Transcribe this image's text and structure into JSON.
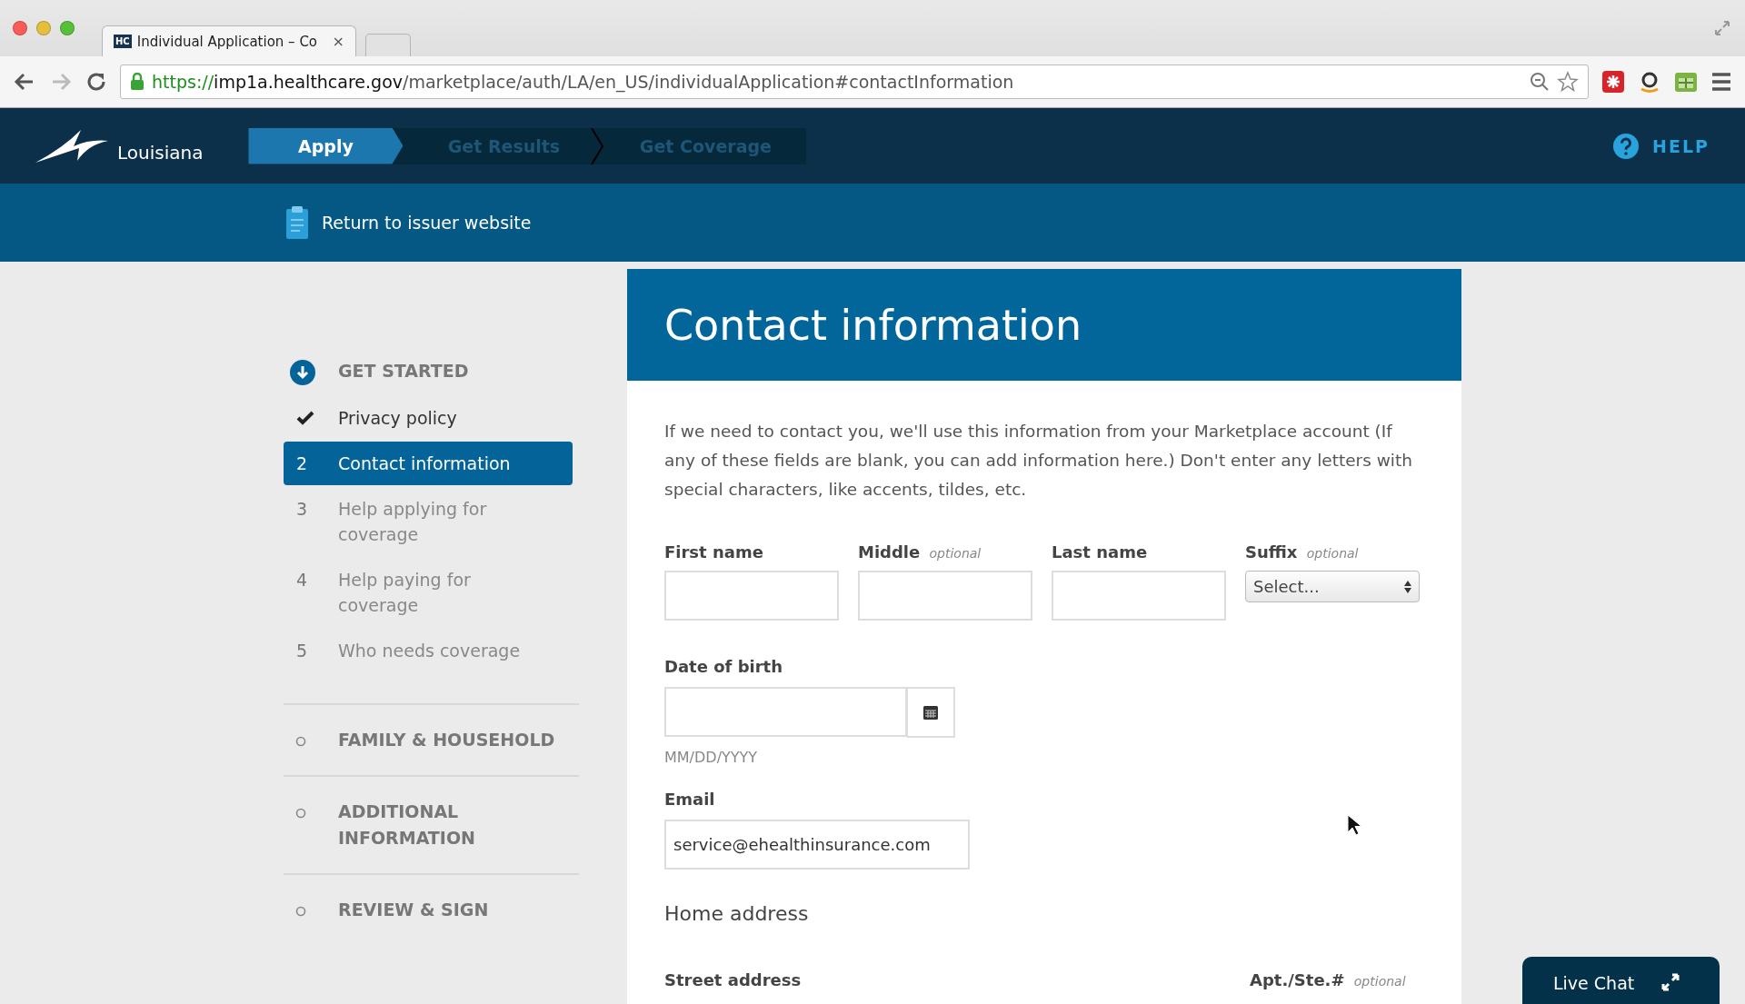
{
  "browser": {
    "tab_favicon": "HC",
    "tab_title": "Individual Application – Co",
    "tab_close": "×",
    "url_scheme": "https://",
    "url_host": "imp1a.healthcare.gov",
    "url_path": "/marketplace/auth/LA/en_US/individualApplication#contactInformation"
  },
  "nav": {
    "brand": "Louisiana",
    "steps": [
      {
        "label": "Apply",
        "selected": true
      },
      {
        "label": "Get Results",
        "selected": false
      },
      {
        "label": "Get Coverage",
        "selected": false
      }
    ],
    "help": "HELP"
  },
  "subbar": {
    "link": "Return to issuer website"
  },
  "sidebar": {
    "sections": [
      {
        "title": "GET STARTED",
        "kind": "current",
        "items": [
          {
            "kind": "done",
            "label": "Privacy policy",
            "selected": false
          },
          {
            "kind": "numbered",
            "number": "2",
            "label": "Contact information",
            "selected": true
          },
          {
            "kind": "numbered",
            "number": "3",
            "label": "Help applying for coverage",
            "selected": false
          },
          {
            "kind": "numbered",
            "number": "4",
            "label": "Help paying for coverage",
            "selected": false
          },
          {
            "kind": "numbered",
            "number": "5",
            "label": "Who needs coverage",
            "selected": false
          }
        ]
      },
      {
        "title": "FAMILY & HOUSEHOLD",
        "kind": "pending"
      },
      {
        "title": "ADDITIONAL INFORMATION",
        "kind": "pending"
      },
      {
        "title": "REVIEW & SIGN",
        "kind": "pending"
      }
    ]
  },
  "form": {
    "title": "Contact information",
    "intro": "If we need to contact you, we'll use this information from your Marketplace account (If any of these fields are blank, you can add information here.) Don't enter any letters with special characters, like accents, tildes, etc.",
    "name_fields": [
      {
        "kind": "text",
        "label": "First name"
      },
      {
        "kind": "text",
        "label": "Middle *optional*"
      },
      {
        "kind": "text",
        "label": "Last name"
      },
      {
        "kind": "select",
        "label": "Suffix *optional*",
        "value": "Select..."
      }
    ],
    "dob": {
      "label": "Date of birth",
      "hint": "MM/DD/YYYY"
    },
    "email": {
      "label": "Email",
      "value": "service@ehealthinsurance.com"
    },
    "home_address": "Home address",
    "address_labels": [
      "Street address",
      "Apt./Ste.# *optional*"
    ]
  },
  "live_chat": "Live Chat"
}
